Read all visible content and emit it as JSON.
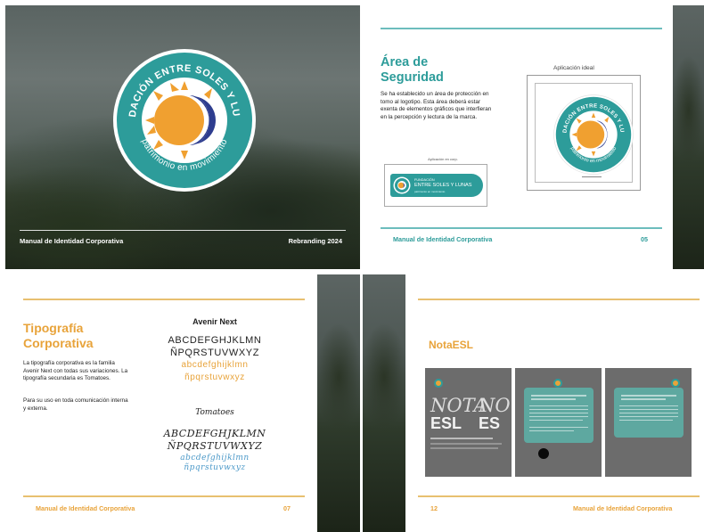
{
  "logo": {
    "arc_text": "FUNDACIÓN ENTRE SOLES Y LUNAS",
    "tagline": "patrimonio en movimiento",
    "colors": {
      "teal": "#2d9c9a",
      "sun": "#f0a030",
      "moon": "#2e3d8f"
    }
  },
  "page_cover": {
    "footer_left": "Manual de Identidad Corporativa",
    "footer_right": "Rebranding 2024"
  },
  "page_safety": {
    "title": "Área de Seguridad",
    "body": "Se ha establecido un área de protección  en tomo al logotipo. Esta área deberá estar exenta de elementos gráficos que interfieran en la percepción y lectura de la marca.",
    "small_label": "Aplicación en corp.",
    "badge_line1": "FUNDACIÓN",
    "badge_line2": "ENTRE SOLES Y LUNAS",
    "badge_line3": "patrimonio en movimiento",
    "ideal_label": "Aplicación ideal",
    "footer_left": "Manual de Identidad Corporativa",
    "footer_right": "05"
  },
  "page_typography": {
    "title": "Tipografía Corporativa",
    "body": "La tipografía corporativa es la familia Avenir Next con todas sus variaciones. La tipografía secundaria es Tomatoes.",
    "body2": "Para su uso en toda comunicación interna y externa.",
    "primary_font": "Avenir Next",
    "upper1": "ABCDEFGHJKLMN",
    "upper2": "ÑPQRSTUVWXYZ",
    "lower1": "abcdefghijklmn",
    "lower2": "ñpqrstuvwxyz",
    "script_font": "Tomatoes",
    "script_upper1": "ABCDEFGHJKLMN",
    "script_upper2": "ÑPQRSTUVWXYZ",
    "script_lower1": "abcdefghijklmn",
    "script_lower2": "ñpqrstuvwxyz",
    "footer_left": "Manual de Identidad Corporativa",
    "footer_right": "07"
  },
  "page_nota": {
    "title": "NotaESL",
    "card1_big1": "NOTA",
    "card1_big2": "ESL",
    "card1_partial_big1": "NO",
    "card1_partial_big2": "ES",
    "footer_left": "12",
    "footer_right": "Manual de Identidad Corporativa"
  }
}
